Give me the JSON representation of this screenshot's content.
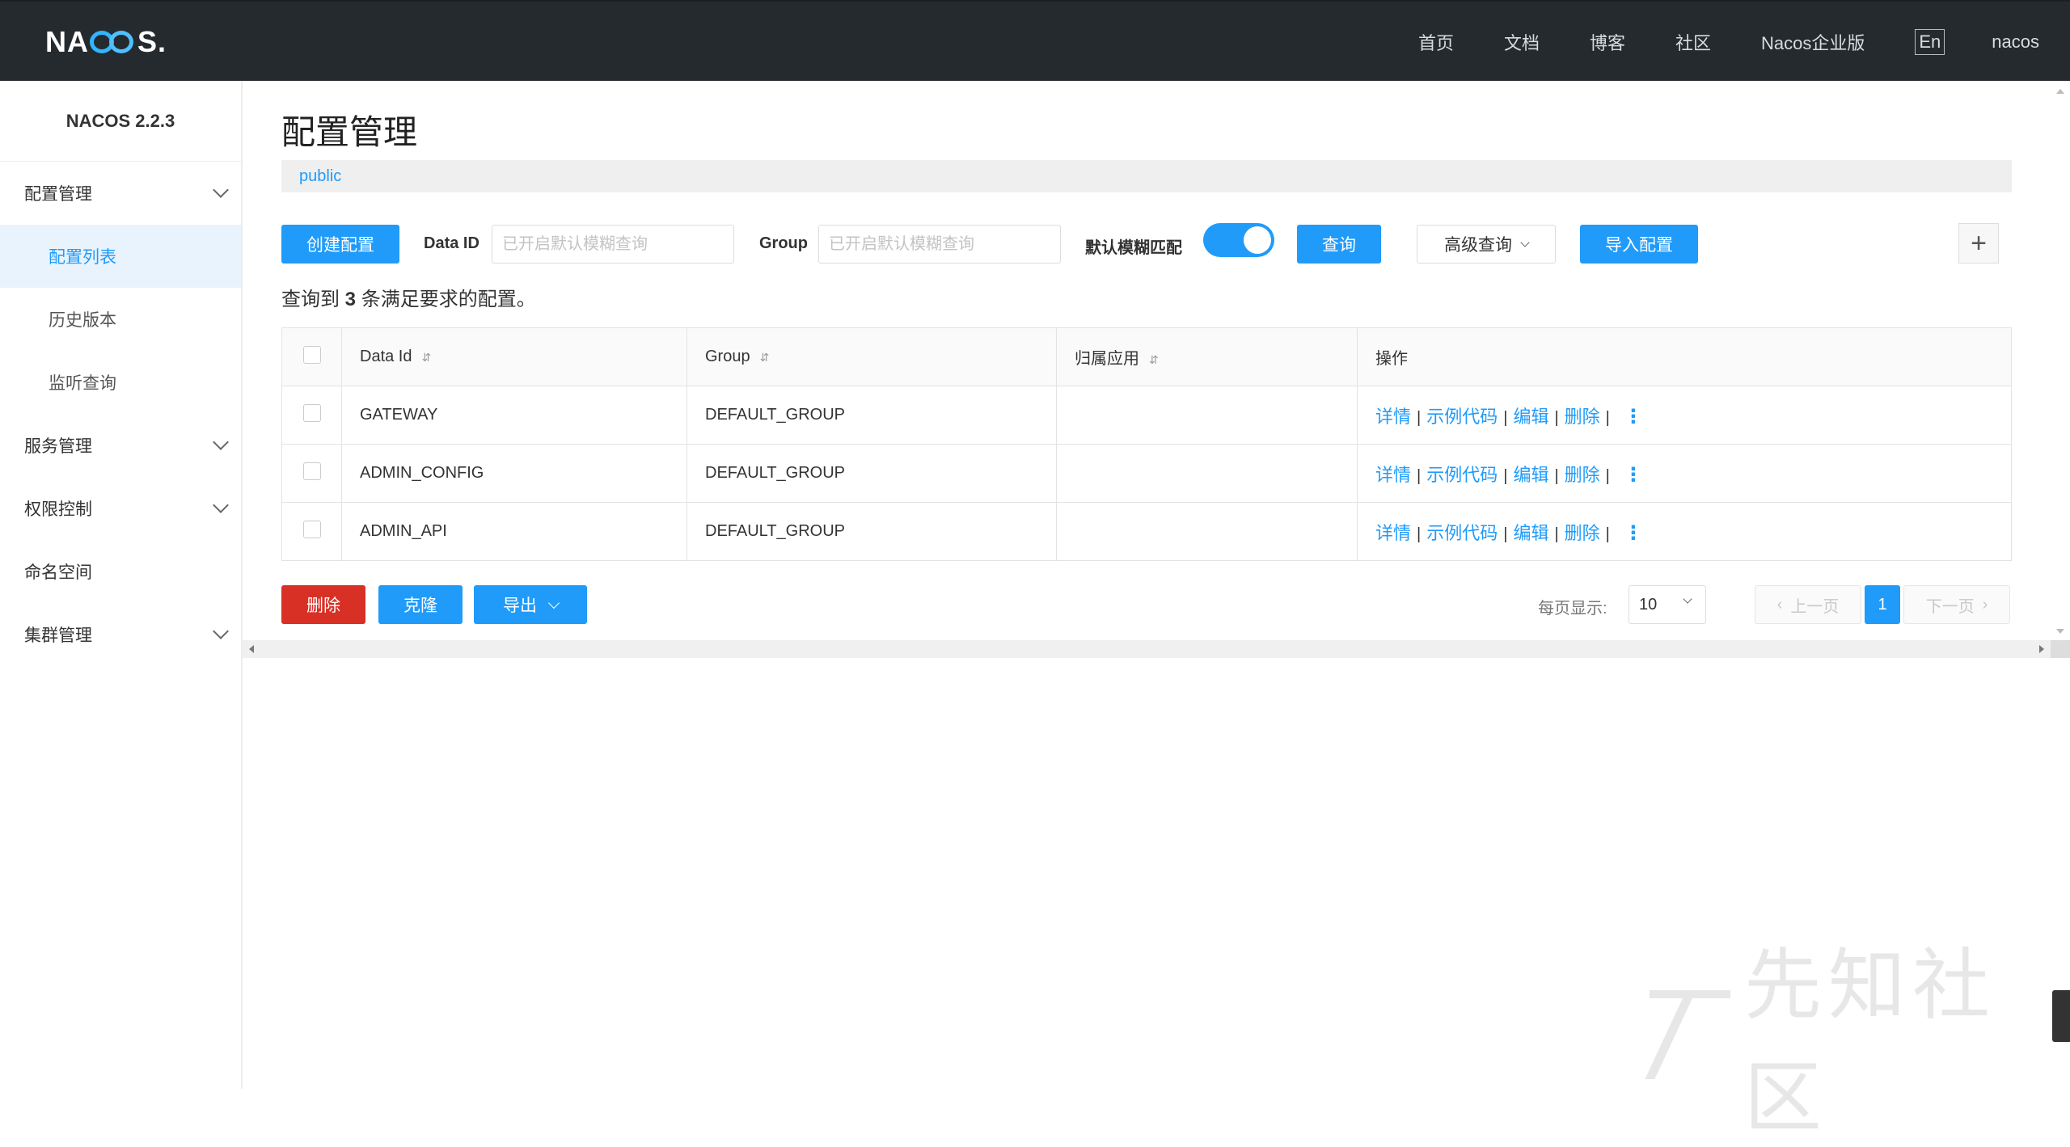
{
  "header": {
    "logo_text": "NACOS.",
    "nav": [
      "首页",
      "文档",
      "博客",
      "社区",
      "Nacos企业版"
    ],
    "lang": "En",
    "user": "nacos"
  },
  "sidebar": {
    "version": "NACOS 2.2.3",
    "items": [
      {
        "label": "配置管理",
        "expandable": true
      },
      {
        "label": "配置列表",
        "active": true,
        "sub": true
      },
      {
        "label": "历史版本",
        "sub": true
      },
      {
        "label": "监听查询",
        "sub": true
      },
      {
        "label": "服务管理",
        "expandable": true
      },
      {
        "label": "权限控制",
        "expandable": true
      },
      {
        "label": "命名空间"
      },
      {
        "label": "集群管理",
        "expandable": true
      }
    ]
  },
  "main": {
    "title": "配置管理",
    "namespace": "public",
    "toolbar": {
      "create_label": "创建配置",
      "dataid_label": "Data ID",
      "dataid_placeholder": "已开启默认模糊查询",
      "group_label": "Group",
      "group_placeholder": "已开启默认模糊查询",
      "fuzzy_label": "默认模糊匹配",
      "fuzzy_on": true,
      "query_label": "查询",
      "advanced_label": "高级查询",
      "import_label": "导入配置",
      "plus": "+"
    },
    "summary": {
      "prefix": "查询到",
      "count": "3",
      "suffix": "条满足要求的配置。"
    },
    "table": {
      "columns": [
        "Data Id",
        "Group",
        "归属应用",
        "操作"
      ],
      "rows": [
        {
          "data_id": "GATEWAY",
          "group": "DEFAULT_GROUP",
          "app": ""
        },
        {
          "data_id": "ADMIN_CONFIG",
          "group": "DEFAULT_GROUP",
          "app": ""
        },
        {
          "data_id": "ADMIN_API",
          "group": "DEFAULT_GROUP",
          "app": ""
        }
      ],
      "ops": {
        "detail": "详情",
        "sample": "示例代码",
        "edit": "编辑",
        "delete": "删除",
        "sep": "|",
        "more": "⋮"
      }
    },
    "bottom": {
      "delete_label": "删除",
      "clone_label": "克隆",
      "export_label": "导出",
      "page_size_label": "每页显示:",
      "page_size": "10",
      "prev_label": "上一页",
      "next_label": "下一页",
      "current_page": "1"
    }
  },
  "watermark": "先知社区",
  "colors": {
    "primary": "#209bfa",
    "danger": "#d93026",
    "header_bg": "#252a2f"
  }
}
